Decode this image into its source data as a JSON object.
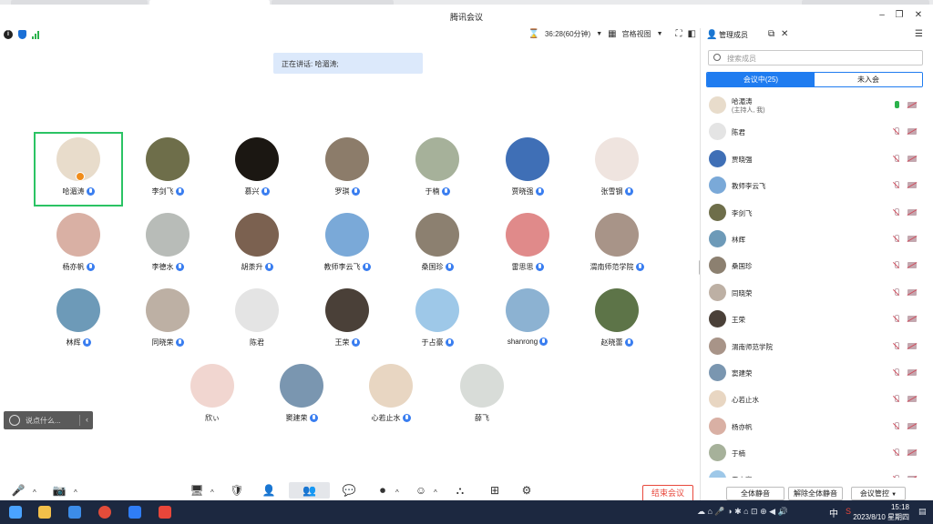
{
  "window": {
    "title": "腾讯会议",
    "controls": {
      "minimize": "–",
      "restore": "❐",
      "close": "✕"
    }
  },
  "toolbar": {
    "info_icon": "i",
    "duration": "36:28(60分钟)",
    "view_mode": "宫格视图",
    "manage_members": "管理成员"
  },
  "speaking": {
    "text": "正在讲话: 哈湄涛;"
  },
  "participants": [
    {
      "name": "哈湄涛",
      "color": "#e8dccb",
      "selected": true,
      "host": true
    },
    {
      "name": "李剑飞",
      "color": "#6e6e4a"
    },
    {
      "name": "慕兴",
      "color": "#1b1712"
    },
    {
      "name": "罗琪",
      "color": "#8c7c6a"
    },
    {
      "name": "于楠",
      "color": "#a6b19a"
    },
    {
      "name": "贾晓强",
      "color": "#3f6fb6"
    },
    {
      "name": "张雪钢",
      "color": "#efe4df"
    },
    {
      "name": "杨亦帆",
      "color": "#d9b0a4"
    },
    {
      "name": "李德水",
      "color": "#b8bcb8"
    },
    {
      "name": "胡荼升",
      "color": "#7b6150"
    },
    {
      "name": "教师李云飞",
      "color": "#7aa9d8"
    },
    {
      "name": "桑国珍",
      "color": "#8c8070"
    },
    {
      "name": "雷思思",
      "color": "#e08a8a"
    },
    {
      "name": "渭南师范学院",
      "color": "#a89488"
    },
    {
      "name": "林辉",
      "color": "#6d9ab8"
    },
    {
      "name": "同晓荣",
      "color": "#bdb0a4"
    },
    {
      "name": "陈君",
      "color": "#e4e4e4",
      "no_badge": true
    },
    {
      "name": "王荣",
      "color": "#4a4038"
    },
    {
      "name": "于占豪",
      "color": "#9ec8e8"
    },
    {
      "name": "shanrong",
      "color": "#8cb2d2"
    },
    {
      "name": "赵晓蕾",
      "color": "#5d7448"
    },
    {
      "name": "欣ぃ",
      "color": "#f1d6d0",
      "no_badge": true
    },
    {
      "name": "窦建荣",
      "color": "#7a96b0"
    },
    {
      "name": "心若止水",
      "color": "#e8d6c2"
    },
    {
      "name": "薛飞",
      "color": "#d8dcd8",
      "no_badge": true
    }
  ],
  "chat": {
    "placeholder": "说点什么..."
  },
  "bottom_controls": {
    "end_meeting": "结束会议"
  },
  "panel": {
    "search_placeholder": "搜索成员",
    "tab_in_meeting": "会议中(25)",
    "tab_not_joined": "未入会",
    "members": [
      {
        "name": "哈湄涛",
        "sub": "(主持人, 我)",
        "color": "#e8dccb",
        "mic_on": true
      },
      {
        "name": "陈君",
        "color": "#e4e4e4"
      },
      {
        "name": "贾晓强",
        "color": "#3f6fb6"
      },
      {
        "name": "教师李云飞",
        "color": "#7aa9d8"
      },
      {
        "name": "李剑飞",
        "color": "#6e6e4a"
      },
      {
        "name": "林辉",
        "color": "#6d9ab8"
      },
      {
        "name": "桑国珍",
        "color": "#8c8070"
      },
      {
        "name": "同晓荣",
        "color": "#bdb0a4"
      },
      {
        "name": "王荣",
        "color": "#4a4038"
      },
      {
        "name": "渭南师范学院",
        "color": "#a89488"
      },
      {
        "name": "窦建荣",
        "color": "#7a96b0"
      },
      {
        "name": "心若止水",
        "color": "#e8d6c2"
      },
      {
        "name": "杨亦帆",
        "color": "#d9b0a4"
      },
      {
        "name": "于楠",
        "color": "#a6b19a"
      },
      {
        "name": "于占豪",
        "color": "#9ec8e8"
      }
    ],
    "mute_all": "全体静音",
    "unmute_all": "解除全体静音",
    "meeting_control": "会议管控"
  },
  "taskbar": {
    "time": "15:18",
    "date": "2023/8/10 星期四",
    "ime": "中"
  }
}
